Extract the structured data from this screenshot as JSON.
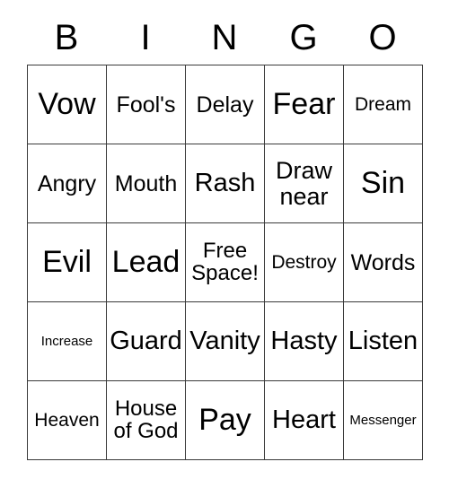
{
  "card": {
    "title_letters": [
      "B",
      "I",
      "N",
      "G",
      "O"
    ],
    "columns": 5,
    "rows": 5,
    "free_space_position": {
      "row": 3,
      "column": 3
    },
    "grid_line_color": "#3a3a3a",
    "background_color": "#ffffff",
    "text_color": "#000000",
    "cells": [
      [
        {
          "text": "Vow",
          "size": "xl"
        },
        {
          "text": "Fool's",
          "size": "md"
        },
        {
          "text": "Delay",
          "size": "md"
        },
        {
          "text": "Fear",
          "size": "xl"
        },
        {
          "text": "Dream",
          "size": "sm"
        }
      ],
      [
        {
          "text": "Angry",
          "size": "md"
        },
        {
          "text": "Mouth",
          "size": "md"
        },
        {
          "text": "Rash",
          "size": "lg"
        },
        {
          "text": "Draw\nnear",
          "size": "two-lg"
        },
        {
          "text": "Sin",
          "size": "xl"
        }
      ],
      [
        {
          "text": "Evil",
          "size": "xl"
        },
        {
          "text": "Lead",
          "size": "xl"
        },
        {
          "text": "Free\nSpace!",
          "size": "two-md"
        },
        {
          "text": "Destroy",
          "size": "sm"
        },
        {
          "text": "Words",
          "size": "md"
        }
      ],
      [
        {
          "text": "Increase",
          "size": "xs"
        },
        {
          "text": "Guard",
          "size": "lg"
        },
        {
          "text": "Vanity",
          "size": "lg"
        },
        {
          "text": "Hasty",
          "size": "lg"
        },
        {
          "text": "Listen",
          "size": "lg"
        }
      ],
      [
        {
          "text": "Heaven",
          "size": "sm"
        },
        {
          "text": "House\nof God",
          "size": "two-md"
        },
        {
          "text": "Pay",
          "size": "xl"
        },
        {
          "text": "Heart",
          "size": "lg"
        },
        {
          "text": "Messenger",
          "size": "xs"
        }
      ]
    ]
  }
}
